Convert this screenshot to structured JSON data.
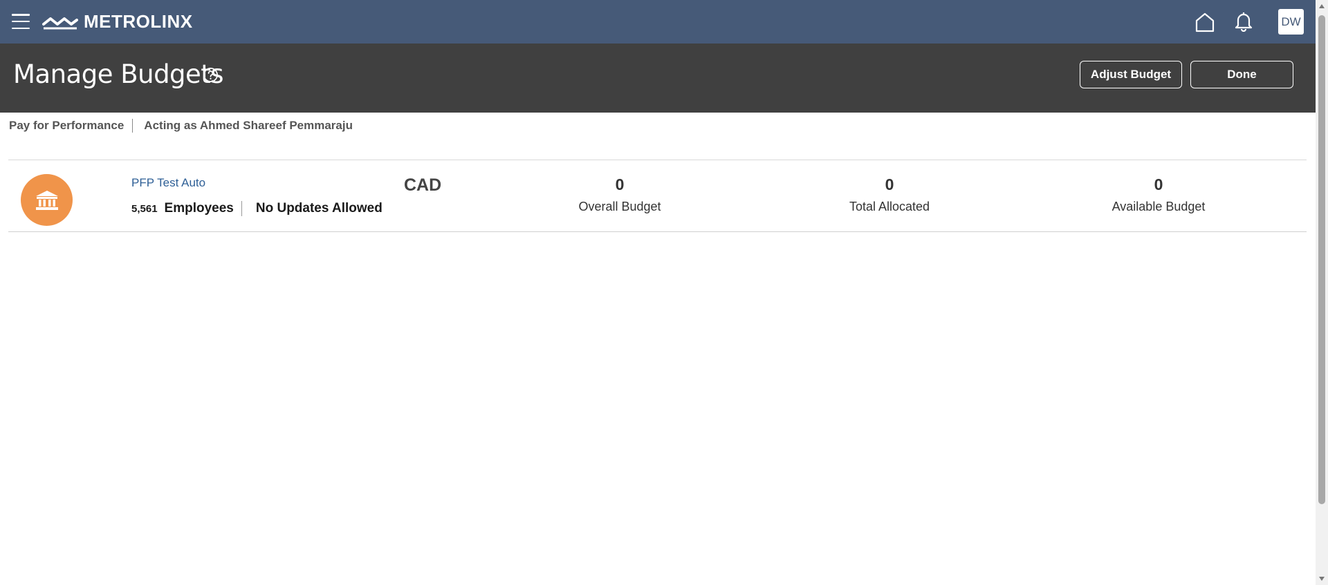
{
  "topbar": {
    "brand": "METROLINX",
    "icons": {
      "menu": "hamburger-menu-icon",
      "home": "home-icon",
      "notifications": "bell-icon"
    },
    "avatar_initials": "DW"
  },
  "header": {
    "title": "Manage Budgets",
    "help_icon": "question-circle-icon",
    "adjust_budget_label": "Adjust Budget",
    "done_label": "Done"
  },
  "context": {
    "plan": "Pay for Performance",
    "acting_as": "Acting as Ahmed Shareef Pemmaraju"
  },
  "budget_row": {
    "org_icon": "bank-building-icon",
    "org_name": "PFP Test Auto",
    "employee_count": "5,561",
    "employees_label": "Employees",
    "status": "No Updates Allowed",
    "currency": "CAD",
    "overall_budget": {
      "value": "0",
      "label": "Overall Budget"
    },
    "total_allocated": {
      "value": "0",
      "label": "Total Allocated"
    },
    "available_budget": {
      "value": "0",
      "label": "Available Budget"
    }
  },
  "colors": {
    "topbar": "#465a78",
    "header": "#404040",
    "org_icon_bg": "#f0944a",
    "link": "#2e5f96"
  }
}
